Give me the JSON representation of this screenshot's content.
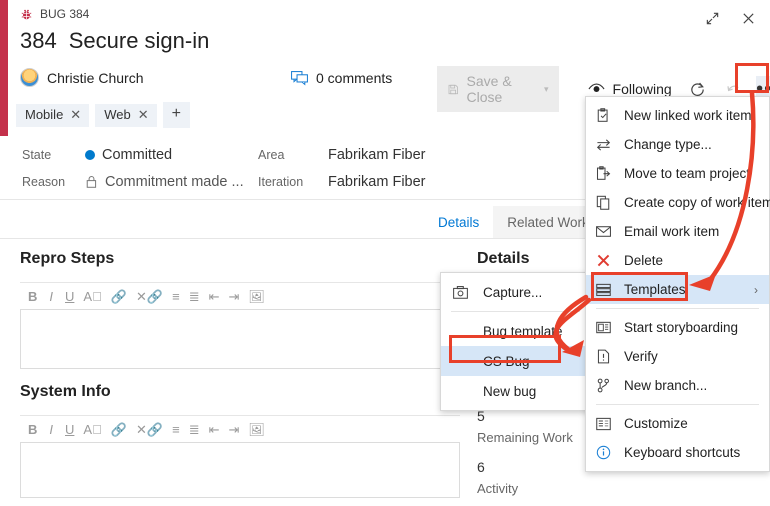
{
  "window": {
    "work_item_type": "BUG 384",
    "expand_icon": "expand-icon",
    "close_icon": "close-icon"
  },
  "header": {
    "id": "384",
    "title": "Secure sign-in",
    "assigned_to": "Christie Church",
    "comments": "0 comments"
  },
  "tags": {
    "items": [
      "Mobile",
      "Web"
    ],
    "add_label": "+"
  },
  "fields": {
    "state_label": "State",
    "state_value": "Committed",
    "reason_label": "Reason",
    "reason_value": "Commitment made ...",
    "area_label": "Area",
    "area_value": "Fabrikam Fiber",
    "iteration_label": "Iteration",
    "iteration_value": "Fabrikam Fiber"
  },
  "toolbar": {
    "save_close": "Save & Close",
    "save_caret": "▾",
    "following": "Following",
    "refresh_icon": "refresh-icon",
    "undo_icon": "undo-icon",
    "more_label": "•••"
  },
  "tabs": [
    {
      "label": "Details",
      "active": true
    },
    {
      "label": "Related Work item",
      "active": false
    }
  ],
  "sections": {
    "repro_steps": "Repro Steps",
    "system_info": "System Info"
  },
  "rte_toolbar": [
    "B",
    "I",
    "U",
    "A",
    "link",
    "unlink",
    "bullets",
    "numbers",
    "outdent",
    "indent",
    "image"
  ],
  "details_panel": {
    "heading": "Details",
    "completed_work_value": "5",
    "remaining_work_label": "Remaining Work",
    "remaining_work_value": "6",
    "activity_label": "Activity"
  },
  "context_menu": {
    "items": [
      {
        "label": "New linked work item",
        "icon": "new-linked-work-item-icon"
      },
      {
        "label": "Change type...",
        "icon": "change-type-icon"
      },
      {
        "label": "Move to team project",
        "icon": "move-to-team-project-icon"
      },
      {
        "label": "Create copy of work item...",
        "icon": "create-copy-icon"
      },
      {
        "label": "Email work item",
        "icon": "email-icon"
      },
      {
        "label": "Delete",
        "icon": "delete-icon"
      },
      {
        "label": "Templates",
        "icon": "templates-icon",
        "chevron": "›",
        "highlighted": true
      },
      {
        "label": "Start storyboarding",
        "icon": "storyboard-icon"
      },
      {
        "label": "Verify",
        "icon": "verify-icon"
      },
      {
        "label": "New branch...",
        "icon": "branch-icon"
      },
      {
        "label": "Customize",
        "icon": "customize-icon"
      },
      {
        "label": "Keyboard shortcuts",
        "icon": "info-icon"
      }
    ]
  },
  "templates_submenu": {
    "items": [
      {
        "label": "Capture...",
        "icon": "camera-icon",
        "highlighted": false
      },
      {
        "label": "Bug template",
        "icon": "",
        "highlighted": false
      },
      {
        "label": "CS Bug",
        "icon": "",
        "highlighted": true
      },
      {
        "label": "New bug",
        "icon": "",
        "highlighted": false
      }
    ]
  },
  "colors": {
    "accent_red": "#c4314b",
    "annotation_red": "#e8402a",
    "link_blue": "#0078d4",
    "state_blue": "#007acc",
    "highlight_blue": "#d6e6f7"
  }
}
